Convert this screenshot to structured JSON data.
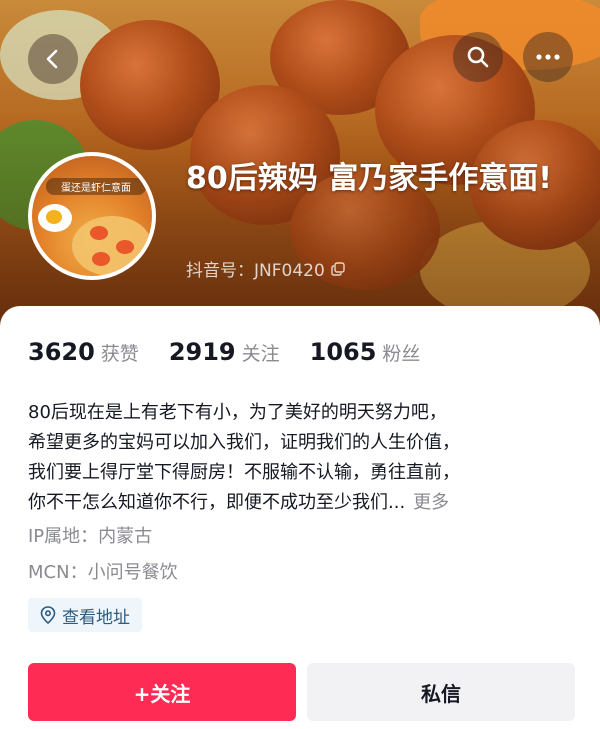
{
  "profile": {
    "nickname": "80后辣妈 富乃家手作意面!",
    "douyin_id": "抖音号：JNF0420",
    "avatar_caption": "蛋还是虾仁意面"
  },
  "stats": [
    {
      "value": "3620",
      "label": "获赞"
    },
    {
      "value": "2919",
      "label": "关注"
    },
    {
      "value": "1065",
      "label": "粉丝"
    }
  ],
  "bio": {
    "lines": [
      "80后现在是上有老下有小，为了美好的明天努力吧，",
      "希望更多的宝妈可以加入我们，证明我们的人生价值，",
      "我们要上得厅堂下得厨房！不服输不认输，勇往直前，",
      "你不干怎么知道你不行，即便不成功至少我们..."
    ],
    "more_label": "更多"
  },
  "meta": {
    "ip": "IP属地：内蒙古",
    "mcn": "MCN：小问号餐饮"
  },
  "address_chip": {
    "label": "查看地址"
  },
  "actions": {
    "follow_label": "+关注",
    "message_label": "私信"
  },
  "colors": {
    "accent": "#fe2c55",
    "secondary_button": "#f2f2f4",
    "muted_text": "#8a8b91",
    "chip_bg": "#eef5fb",
    "chip_text": "#2e5b80"
  },
  "icons": {
    "back": "chevron-left-icon",
    "search": "search-icon",
    "more": "more-icon",
    "copy": "copy-icon",
    "location": "location-pin-icon"
  }
}
